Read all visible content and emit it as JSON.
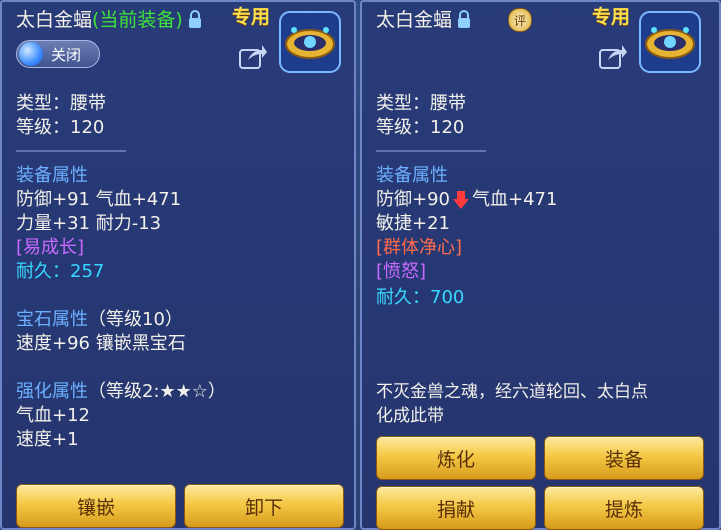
{
  "left": {
    "title_name": "太白金蝠",
    "title_equip": "(当前装备)",
    "special": "专用",
    "toggle_label": "关闭",
    "type_line": "类型：腰带",
    "level_line": "等级：120",
    "equip_attr_header": "装备属性",
    "attr1": "防御+91 气血+471",
    "attr2": "力量+31 耐力-13",
    "special_trait": "[易成长]",
    "durability_label": "耐久：",
    "durability_value": "257",
    "gem_header": "宝石属性",
    "gem_level": "（等级10）",
    "gem_line": "速度+96 镶嵌黑宝石",
    "enhance_header": "强化属性",
    "enhance_level": "（等级2:★★☆）",
    "enhance1": "气血+12",
    "enhance2": "速度+1",
    "btn_inlay": "镶嵌",
    "btn_unequip": "卸下"
  },
  "right": {
    "title_name": "太白金蝠",
    "special": "专用",
    "rating_badge": "评",
    "type_line": "类型：腰带",
    "level_line": "等级：120",
    "equip_attr_header": "装备属性",
    "attr_def": "防御+90",
    "attr_hp": "气血+471",
    "attr2": "敏捷+21",
    "trait1": "[群体净心]",
    "trait2": "[愤怒]",
    "durability_label": "耐久：",
    "durability_value": "700",
    "desc1": "不灭金兽之魂，经六道轮回、太白点",
    "desc2": "化成此带",
    "btn_refine": "炼化",
    "btn_equip": "装备",
    "btn_donate": "捐献",
    "btn_extract": "提炼"
  },
  "colors": {
    "equipped_green": "#3fe23a",
    "special_gold": "#ffe04a",
    "header_blue": "#6cb0ff",
    "trait_purple": "#c86aff",
    "trait_red": "#ff6b4a",
    "durability_cyan": "#37d8ff",
    "button_gold": "#f3c945"
  }
}
